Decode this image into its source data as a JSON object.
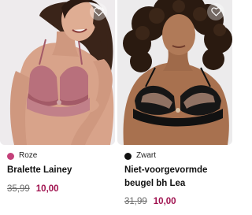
{
  "products": [
    {
      "color_name": "Roze",
      "color_swatch": "#c4417a",
      "title": "Bralette Lainey",
      "old_price": "35,99",
      "new_price": "10,00",
      "favorite_icon": "heart-outline-icon"
    },
    {
      "color_name": "Zwart",
      "color_swatch": "#111111",
      "title": "Niet-voorgevormde beugel bh Lea",
      "old_price": "31,99",
      "new_price": "10,00",
      "favorite_icon": "heart-outline-icon"
    }
  ],
  "colors": {
    "sale_price": "#a0124f",
    "old_price": "#6b6b6b"
  }
}
